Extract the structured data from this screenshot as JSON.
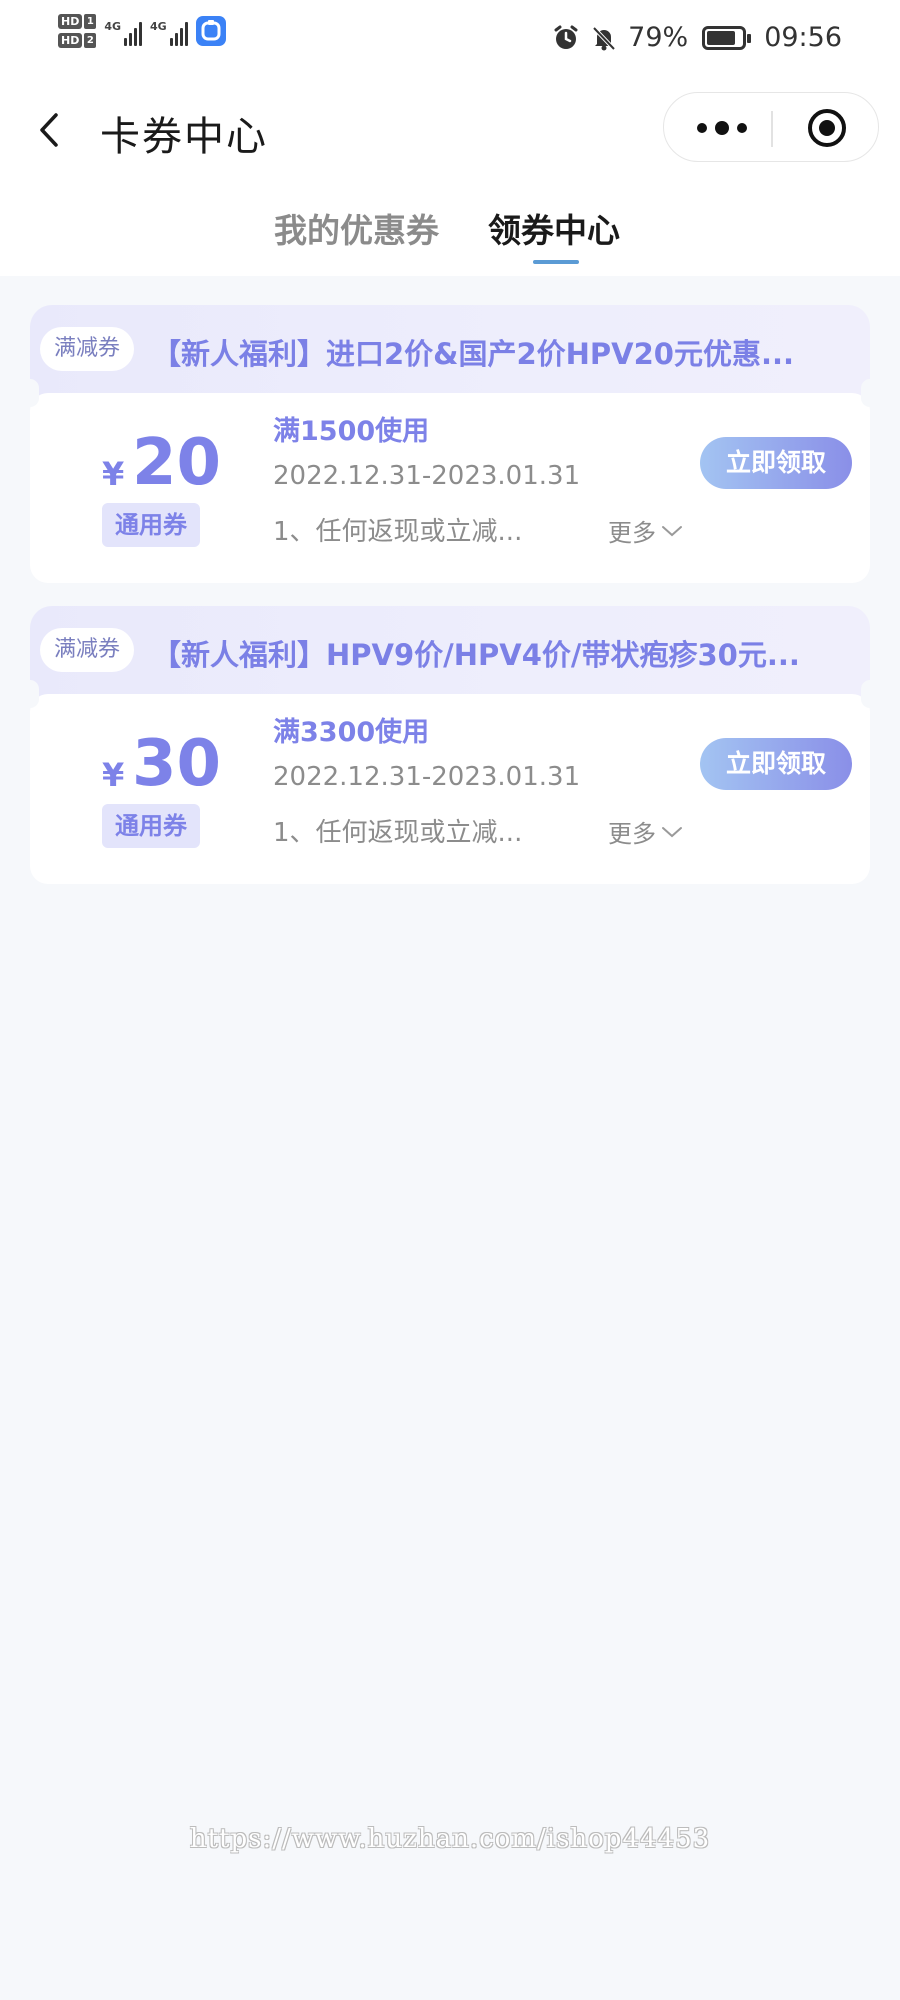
{
  "status_bar": {
    "hd1": "HD",
    "hd1_num": "1",
    "hd2": "HD",
    "hd2_num": "2",
    "net1": "4G",
    "net2": "4G",
    "battery_percent": "79%",
    "time": "09:56",
    "app_icon": "shield-icon"
  },
  "nav": {
    "title": "卡券中心",
    "back_icon": "chevron-left-icon",
    "more_icon": "more-dots-icon",
    "close_icon": "target-circle-icon"
  },
  "tabs": [
    {
      "label": "我的优惠券",
      "active": false
    },
    {
      "label": "领券中心",
      "active": true
    }
  ],
  "coupons": [
    {
      "type_tag": "满减券",
      "title": "【新人福利】进口2价&国产2价HPV20元优惠...",
      "currency": "¥",
      "amount": "20",
      "scope_tag": "通用券",
      "threshold": "满1500使用",
      "validity": "2022.12.31-2023.01.31",
      "rule": "1、任何返现或立减...",
      "more_label": "更多",
      "button_label": "立即领取"
    },
    {
      "type_tag": "满减券",
      "title": "【新人福利】HPV9价/HPV4价/带状疱疹30元...",
      "currency": "¥",
      "amount": "30",
      "scope_tag": "通用券",
      "threshold": "满3300使用",
      "validity": "2022.12.31-2023.01.31",
      "rule": "1、任何返现或立减...",
      "more_label": "更多",
      "button_label": "立即领取"
    }
  ],
  "watermark": "https://www.huzhan.com/ishop44453",
  "colors": {
    "accent": "#7d82e8",
    "tab_underline": "#5b9bd5",
    "background": "#f6f8fb"
  }
}
